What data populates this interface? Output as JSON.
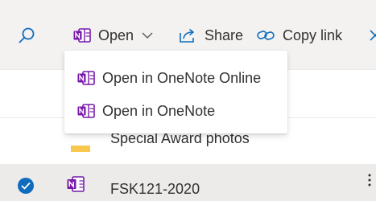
{
  "toolbar": {
    "open_label": "Open",
    "share_label": "Share",
    "copy_link_label": "Copy link"
  },
  "open_menu": {
    "items": [
      {
        "label": "Open in OneNote Online",
        "icon": "onenote-icon"
      },
      {
        "label": "Open in OneNote",
        "icon": "onenote-icon"
      }
    ]
  },
  "file_list": {
    "rows": [
      {
        "name": "Special Award photos",
        "type": "folder",
        "selected": false
      },
      {
        "name": "FSK121-2020",
        "type": "onenote-notebook",
        "selected": true
      }
    ]
  },
  "colors": {
    "accent": "#0f6cbd",
    "onenote": "#7719aa",
    "folder": "#f8c84e",
    "toolbar_bg": "#f3f2f1",
    "selected_row_bg": "#edebe9"
  }
}
